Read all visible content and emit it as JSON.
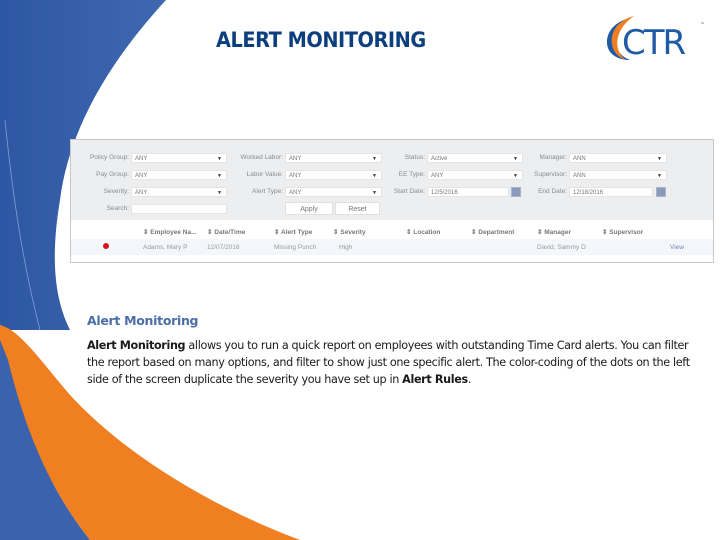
{
  "slide": {
    "title": "ALERT MONITORING",
    "logo_text": "CTR",
    "logo_tm": "™",
    "colors": {
      "blue_band": "#3a62ad",
      "orange_band": "#f07f22",
      "title_blue": "#0d3f7e",
      "heading_blue": "#4c6ea8",
      "alert_dot_red": "#d4141c",
      "link_blue": "#6e86c2"
    }
  },
  "filters": {
    "policy_group": {
      "label": "Policy Group:",
      "value": "ANY"
    },
    "pay_group": {
      "label": "Pay Group:",
      "value": "ANY"
    },
    "severity": {
      "label": "Severity:",
      "value": "ANY"
    },
    "search": {
      "label": "Search:",
      "value": ""
    },
    "worked_labor": {
      "label": "Worked Labor:",
      "value": "ANY"
    },
    "labor_value": {
      "label": "Labor Value:",
      "value": "ANY"
    },
    "alert_type": {
      "label": "Alert Type:",
      "value": "ANY"
    },
    "status": {
      "label": "Status:",
      "value": "Active"
    },
    "ee_type": {
      "label": "EE Type:",
      "value": "ANY"
    },
    "start_date": {
      "label": "Start Date:",
      "value": "12/5/2016"
    },
    "manager": {
      "label": "Manager:",
      "value": "ANN"
    },
    "supervisor": {
      "label": "Supervisor:",
      "value": "ANN"
    },
    "end_date": {
      "label": "End Date:",
      "value": "12/18/2016"
    },
    "apply_label": "Apply",
    "reset_label": "Reset",
    "caret": "▼"
  },
  "table": {
    "sort_glyph": "⇕",
    "columns": [
      "Employee Na...",
      "Date/Time",
      "Alert Type",
      "Severity",
      "Location",
      "Department",
      "Manager",
      "Supervisor"
    ],
    "rows": [
      {
        "severity_color": "#d4141c",
        "employee": "Adams, Mary P",
        "datetime": "12/07/2016",
        "alert_type": "Missing Punch",
        "severity": "High",
        "location": "",
        "department": "",
        "manager": "David, Sammy D",
        "supervisor": "",
        "action": "View"
      }
    ]
  },
  "description": {
    "heading": "Alert Monitoring",
    "lead_bold": "Alert Monitoring",
    "text_1": " allows you to run a quick report on employees with outstanding Time Card alerts. You can filter the report based on many options, and filter to show just one specific alert. The color-coding of the dots on the left side of the screen duplicate the severity you have set up in ",
    "trail_bold": "Alert Rules",
    "text_2": "."
  }
}
